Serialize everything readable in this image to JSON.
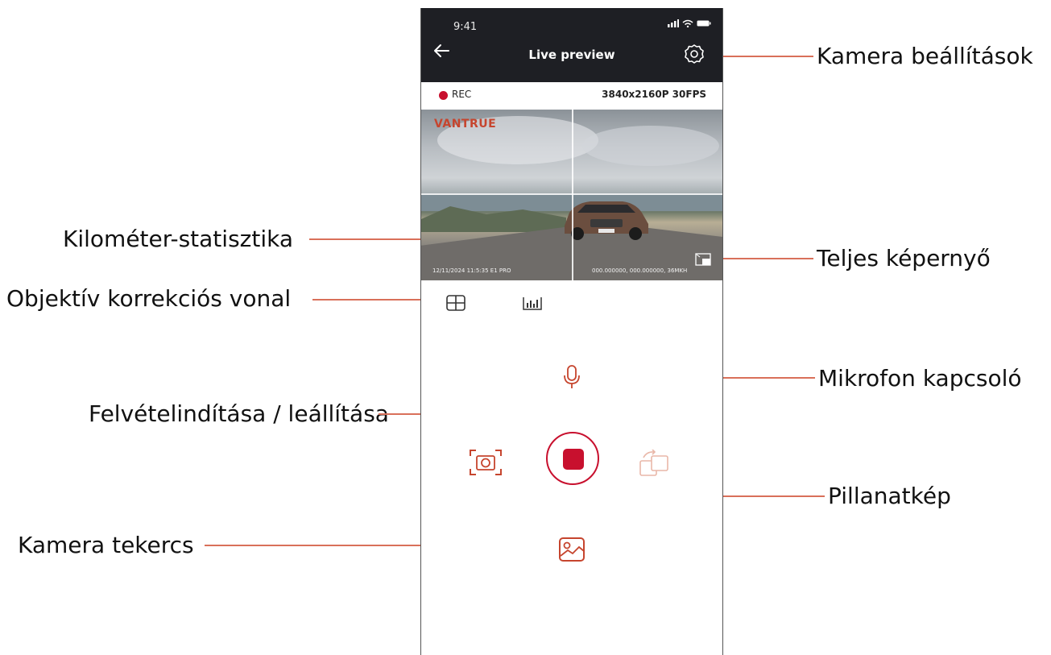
{
  "phone": {
    "status_time": "9:41",
    "title": "Live preview",
    "rec_label": "REC",
    "resolution": "3840x2160P 30FPS",
    "video": {
      "watermark": "VANTRUE",
      "timestamp": "12/11/2024 11:5:35  E1 PRO",
      "gps": "000.000000,  000.000000,  36MKH"
    }
  },
  "annotations": {
    "camera_settings": "Kamera beállítások",
    "mileage_stats": "Kilométer-statisztika",
    "fullscreen": "Teljes képernyő",
    "lens_correction": "Objektív korrekciós vonal",
    "mic_toggle": "Mikrofon kapcsoló",
    "record_toggle": "Felvételindítása / leállítása",
    "snapshot": "Pillanatkép",
    "camera_roll": "Kamera tekercs"
  },
  "colors": {
    "accent": "#c8102e",
    "icon": "#c6452e",
    "header_bg": "#1e1f24",
    "leader_line": "#d9705a"
  },
  "icons": [
    "back-arrow-icon",
    "gear-icon",
    "fullscreen-icon",
    "grid-icon",
    "bar-chart-icon",
    "microphone-icon",
    "camera-snapshot-icon",
    "stop-record-icon",
    "switch-camera-icon",
    "gallery-icon"
  ]
}
